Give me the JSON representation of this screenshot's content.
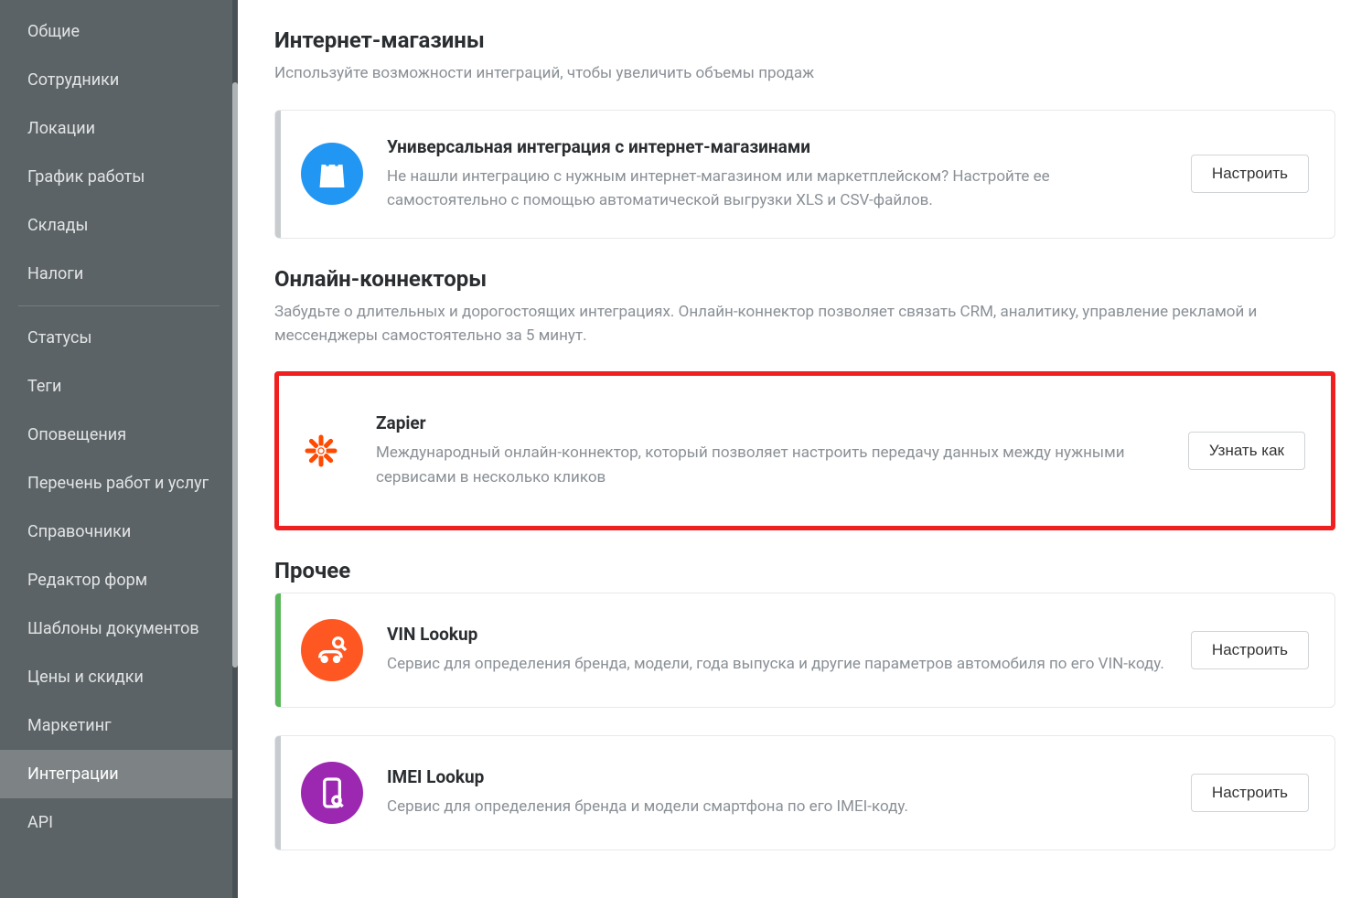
{
  "sidebar": {
    "items_group1": [
      {
        "label": "Общие"
      },
      {
        "label": "Сотрудники"
      },
      {
        "label": "Локации"
      },
      {
        "label": "График работы"
      },
      {
        "label": "Склады"
      },
      {
        "label": "Налоги"
      }
    ],
    "items_group2": [
      {
        "label": "Статусы"
      },
      {
        "label": "Теги"
      },
      {
        "label": "Оповещения"
      },
      {
        "label": "Перечень работ и услуг"
      },
      {
        "label": "Справочники"
      },
      {
        "label": "Редактор форм"
      },
      {
        "label": "Шаблоны документов"
      },
      {
        "label": "Цены и скидки"
      },
      {
        "label": "Маркетинг"
      },
      {
        "label": "Интеграции",
        "active": true
      },
      {
        "label": "API"
      }
    ]
  },
  "sections": {
    "shops": {
      "title": "Интернет-магазины",
      "desc": "Используйте возможности интеграций, чтобы увеличить объемы продаж",
      "card": {
        "title": "Универсальная интеграция с интернет-магазинами",
        "desc": "Не нашли интеграцию с нужным интернет-магазином или маркетплейском? Настройте ее самостоятельно с помощью автоматической выгрузки XLS и CSV-файлов.",
        "button": "Настроить"
      }
    },
    "connectors": {
      "title": "Онлайн-коннекторы",
      "desc": "Забудьте о длительных и дорогостоящих интеграциях. Онлайн-коннектор позволяет связать CRM, аналитику, управление рекламой и мессенджеры самостоятельно за 5 минут.",
      "card": {
        "title": "Zapier",
        "desc": "Международный онлайн-коннектор, который позволяет настроить передачу данных между нужными сервисами в несколько кликов",
        "button": "Узнать как"
      }
    },
    "other": {
      "title": "Прочее",
      "vin": {
        "title": "VIN Lookup",
        "desc": "Сервис для определения бренда, модели, года выпуска и другие параметров автомобиля по его VIN-коду.",
        "button": "Настроить"
      },
      "imei": {
        "title": "IMEI Lookup",
        "desc": "Сервис для определения бренда и модели смартфона по его IMEI-коду.",
        "button": "Настроить"
      }
    }
  }
}
